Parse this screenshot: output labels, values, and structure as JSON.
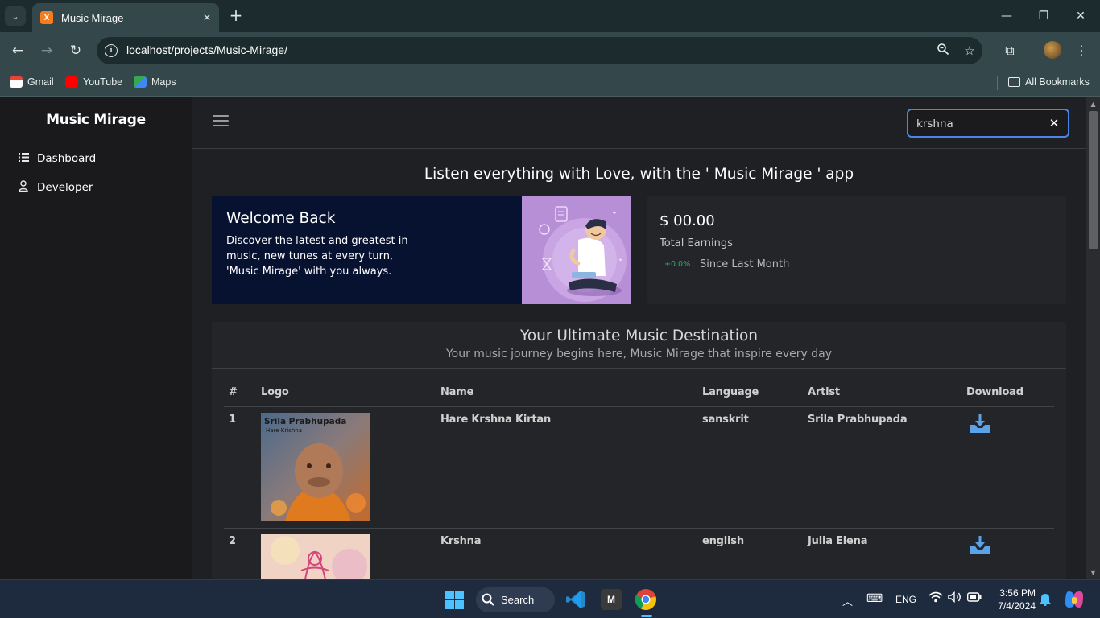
{
  "browser": {
    "tab_title": "Music Mirage",
    "tab_favicon": "X",
    "url": "localhost/projects/Music-Mirage/",
    "bookmarks": [
      {
        "label": "Gmail",
        "icon": "gmail-icon",
        "color": "#ea4335"
      },
      {
        "label": "YouTube",
        "icon": "youtube-icon",
        "color": "#ff0000"
      },
      {
        "label": "Maps",
        "icon": "maps-icon",
        "color": "#34a853"
      }
    ],
    "all_bookmarks": "All Bookmarks"
  },
  "sidebar": {
    "brand": "Music Mirage",
    "items": [
      {
        "label": "Dashboard",
        "icon": "list-icon"
      },
      {
        "label": "Developer",
        "icon": "user-icon"
      }
    ]
  },
  "topbar": {
    "search_value": "krshna"
  },
  "main": {
    "heading": "Listen everything with Love, with the ' Music Mirage ' app",
    "welcome": {
      "title": "Welcome Back",
      "text": "Discover the latest and greatest in music, new tunes at every turn, 'Music Mirage' with you always."
    },
    "earnings": {
      "amount": "$ 00.00",
      "label": "Total Earnings",
      "change": "+0.0%",
      "since": "Since Last Month",
      "change_color": "#22b573"
    },
    "card": {
      "title": "Your Ultimate Music Destination",
      "subtitle": "Your music journey begins here, Music Mirage that inspire every day"
    },
    "table": {
      "headers": [
        "#",
        "Logo",
        "Name",
        "Language",
        "Artist",
        "Download"
      ],
      "rows": [
        {
          "num": "1",
          "logo_text": "Srila Prabhupada",
          "logo_sub": "Hare Krishna",
          "name": "Hare Krshna Kirtan",
          "language": "sanskrit",
          "artist": "Srila Prabhupada"
        },
        {
          "num": "2",
          "logo_text": "",
          "logo_sub": "",
          "name": "Krshna",
          "language": "english",
          "artist": "Julia Elena"
        }
      ]
    }
  },
  "taskbar": {
    "search_label": "Search",
    "language": "ENG",
    "time": "3:56 PM",
    "date": "7/4/2024",
    "accent": "#4cc2ff"
  }
}
